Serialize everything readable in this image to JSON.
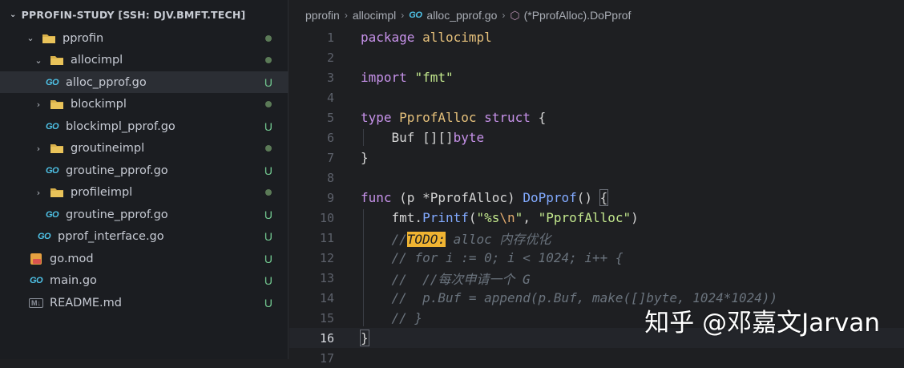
{
  "sidebar": {
    "title": "PPROFIN-STUDY [SSH: DJV.BMFT.TECH]",
    "items": [
      {
        "label": "pprofin",
        "icon": "folder-icon",
        "status": "dot"
      },
      {
        "label": "allocimpl",
        "icon": "folder-icon",
        "status": "dot"
      },
      {
        "label": "alloc_pprof.go",
        "icon": "go-file-icon",
        "status": "U"
      },
      {
        "label": "blockimpl",
        "icon": "folder-icon",
        "status": ""
      },
      {
        "label": "blockimpl_pprof.go",
        "icon": "go-file-icon",
        "status": "U"
      },
      {
        "label": "groutineimpl",
        "icon": "folder-icon",
        "status": ""
      },
      {
        "label": "groutine_pprof.go",
        "icon": "go-file-icon",
        "status": "U"
      },
      {
        "label": "profileimpl",
        "icon": "folder-icon",
        "status": ""
      },
      {
        "label": "groutine_pprof.go",
        "icon": "go-file-icon",
        "status": "U"
      },
      {
        "label": "pprof_interface.go",
        "icon": "go-file-icon",
        "status": "U"
      },
      {
        "label": "go.mod",
        "icon": "go-mod-icon",
        "status": "U"
      },
      {
        "label": "main.go",
        "icon": "go-file-icon",
        "status": "U"
      },
      {
        "label": "README.md",
        "icon": "markdown-icon",
        "status": "U"
      }
    ]
  },
  "breadcrumb": {
    "parts": [
      "pprofin",
      "allocimpl",
      "alloc_pprof.go",
      "(*PprofAlloc).DoPprof"
    ],
    "go_label": "GO"
  },
  "editor": {
    "line_numbers": [
      "1",
      "2",
      "3",
      "4",
      "5",
      "6",
      "7",
      "8",
      "9",
      "10",
      "11",
      "12",
      "13",
      "14",
      "15",
      "16",
      "17"
    ],
    "current_line": "16"
  },
  "code": {
    "l1": [
      "package",
      "allocimpl"
    ],
    "l3": [
      "import",
      "\"fmt\""
    ],
    "l5": [
      "type",
      "PprofAlloc",
      "struct",
      "{"
    ],
    "l6": [
      "Buf",
      "[][]",
      "byte"
    ],
    "l7": [
      "}"
    ],
    "l9": [
      "func",
      "(p *PprofAlloc)",
      "DoPprof",
      "()",
      "{"
    ],
    "l10": [
      "fmt.",
      "Printf",
      "(",
      "\"%s",
      "\\n",
      "\"",
      ", ",
      "\"PprofAlloc\"",
      ")"
    ],
    "l11": [
      "//",
      "TODO:",
      " alloc 内存优化"
    ],
    "l12": "// for i := 0; i < 1024; i++ {",
    "l13": "//  //每次申请一个 G",
    "l14": "//  p.Buf = append(p.Buf, make([]byte, 1024*1024))",
    "l15": "// }",
    "l16": "}"
  },
  "watermark": "知乎 @邓嘉文Jarvan",
  "colors": {
    "accent": "#f0b432",
    "untracked": "#73c991",
    "go_blue": "#4fc3e8"
  }
}
